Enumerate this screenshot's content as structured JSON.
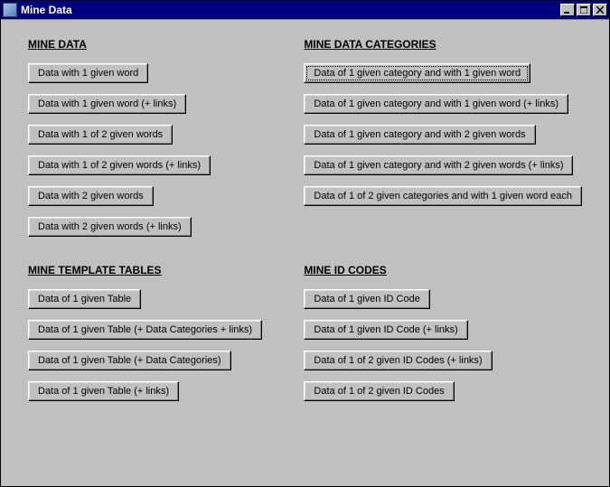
{
  "window": {
    "title": "Mine Data"
  },
  "sections": {
    "mineData": {
      "heading": "MINE DATA ",
      "buttons": [
        "Data with 1 given word",
        "Data with 1 given word (+ links)",
        "Data with 1 of 2 given words",
        "Data with 1 of 2 given words (+ links)",
        "Data with 2 given words",
        "Data with 2 given words (+ links)"
      ]
    },
    "mineDataCategories": {
      "heading": "MINE DATA CATEGORIES",
      "buttons": [
        "Data of 1 given category and with 1 given word",
        "Data of 1 given category and with 1 given word (+ links)",
        "Data of 1 given category and with 2 given words",
        "Data of 1 given category and with 2 given words (+ links)",
        "Data of 1 of 2 given categories and with 1 given word each"
      ]
    },
    "mineTemplateTables": {
      "heading": "MINE TEMPLATE TABLES",
      "buttons": [
        "Data of 1 given Table",
        "Data of 1 given Table (+ Data Categories + links)",
        "Data of 1 given Table (+ Data Categories)",
        "Data of 1 given Table (+ links)"
      ]
    },
    "mineIdCodes": {
      "heading": "MINE ID CODES",
      "buttons": [
        "Data of 1 given ID Code",
        "Data of 1 given ID Code (+ links)",
        "Data of 1 of 2 given ID Codes (+ links)",
        "Data of 1 of 2 given ID Codes"
      ]
    }
  }
}
